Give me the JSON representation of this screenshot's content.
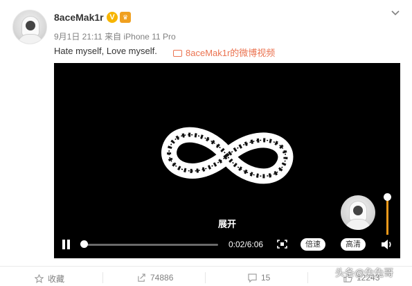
{
  "post": {
    "username": "8aceMak1r",
    "verified_badge": "V",
    "meta": "9月1日 21:11 来自 iPhone 11 Pro",
    "text": "Hate myself, Love myself.",
    "video_link": "8aceMak1r的微博视频",
    "icons": {
      "verified": "verified-v-icon",
      "vip": "vip-crown-icon",
      "menu": "chevron-down-icon",
      "video_link": "video-camera-icon"
    }
  },
  "video": {
    "expand_label": "展开",
    "time": "0:02/6:06",
    "speed_label": "倍速",
    "quality_label": "高清",
    "progress_fraction": 0.005,
    "volume_fraction": 1.0,
    "accent_color": "#f09a1a"
  },
  "actions": {
    "favorite": "收藏",
    "share_count": "74886",
    "comment_count": "15",
    "like_count": "12243"
  },
  "watermark": "头条@兔兔哥",
  "colors": {
    "link": "#eb7350",
    "verified": "#f7b500",
    "meta_text": "#808080"
  }
}
